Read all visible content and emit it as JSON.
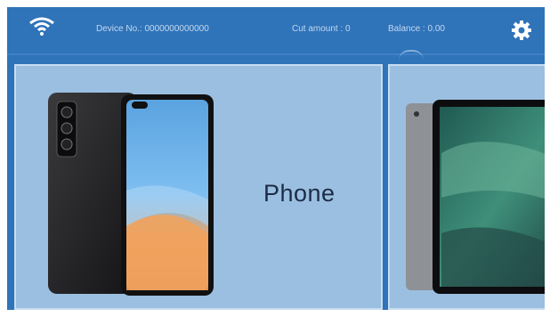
{
  "status_bar": {
    "device_no": "Device No.: 0000000000000",
    "cut_amount": "Cut amount : 0",
    "balance": "Balance : 0.00"
  },
  "cards": {
    "phone_label": "Phone"
  },
  "icons": {
    "wifi": "wifi-icon",
    "settings": "settings-icon"
  },
  "colors": {
    "header_blue": "#2f73b9",
    "card_blue": "#9bbfe0",
    "text_dark": "#1d2c46"
  }
}
